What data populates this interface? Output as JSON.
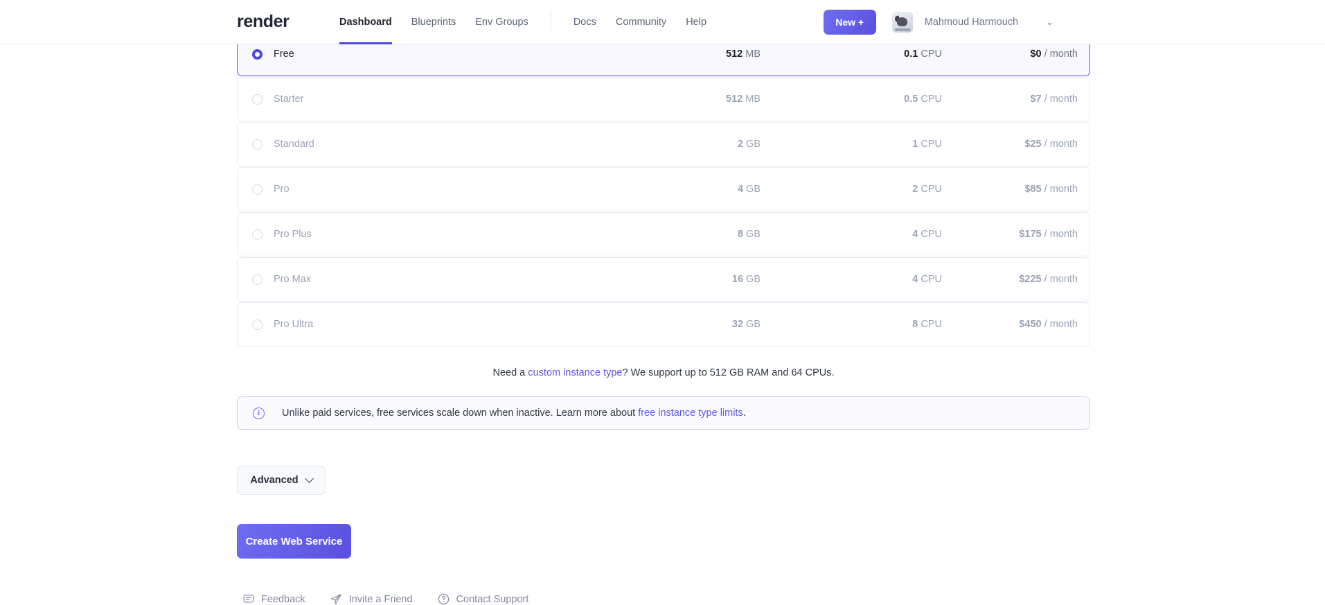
{
  "header": {
    "brand": "render",
    "nav": [
      {
        "label": "Dashboard",
        "active": true
      },
      {
        "label": "Blueprints",
        "active": false
      },
      {
        "label": "Env Groups",
        "active": false
      }
    ],
    "nav_right": [
      {
        "label": "Docs"
      },
      {
        "label": "Community"
      },
      {
        "label": "Help"
      }
    ],
    "new_button": "New +",
    "user_name": "Mahmoud Harmouch",
    "chevron": "⌄",
    "accent_color": "#4f46e5"
  },
  "plans": {
    "rows": [
      {
        "name": "Free",
        "ram_value": "512",
        "ram_unit": "MB",
        "cpu_value": "0.1",
        "cpu_unit": "CPU",
        "price": "$0",
        "period": "/ month",
        "selected": true
      },
      {
        "name": "Starter",
        "ram_value": "512",
        "ram_unit": "MB",
        "cpu_value": "0.5",
        "cpu_unit": "CPU",
        "price": "$7",
        "period": "/ month",
        "selected": false
      },
      {
        "name": "Standard",
        "ram_value": "2",
        "ram_unit": "GB",
        "cpu_value": "1",
        "cpu_unit": "CPU",
        "price": "$25",
        "period": "/ month",
        "selected": false
      },
      {
        "name": "Pro",
        "ram_value": "4",
        "ram_unit": "GB",
        "cpu_value": "2",
        "cpu_unit": "CPU",
        "price": "$85",
        "period": "/ month",
        "selected": false
      },
      {
        "name": "Pro Plus",
        "ram_value": "8",
        "ram_unit": "GB",
        "cpu_value": "4",
        "cpu_unit": "CPU",
        "price": "$175",
        "period": "/ month",
        "selected": false
      },
      {
        "name": "Pro Max",
        "ram_value": "16",
        "ram_unit": "GB",
        "cpu_value": "4",
        "cpu_unit": "CPU",
        "price": "$225",
        "period": "/ month",
        "selected": false
      },
      {
        "name": "Pro Ultra",
        "ram_value": "32",
        "ram_unit": "GB",
        "cpu_value": "8",
        "cpu_unit": "CPU",
        "price": "$450",
        "period": "/ month",
        "selected": false
      }
    ]
  },
  "custom_note": {
    "prefix": "Need a ",
    "link": "custom instance type",
    "suffix": "? We support up to 512 GB RAM and 64 CPUs."
  },
  "banner": {
    "icon": "i",
    "text_prefix": "Unlike paid services, free services scale down when inactive. Learn more about ",
    "link": "free instance type limits",
    "text_suffix": "."
  },
  "actions": {
    "advanced": "Advanced",
    "create": "Create Web Service"
  },
  "footer": [
    {
      "label": "Feedback",
      "icon": "feedback-icon"
    },
    {
      "label": "Invite a Friend",
      "icon": "paper-plane-icon"
    },
    {
      "label": "Contact Support",
      "icon": "question-circle-icon"
    }
  ]
}
